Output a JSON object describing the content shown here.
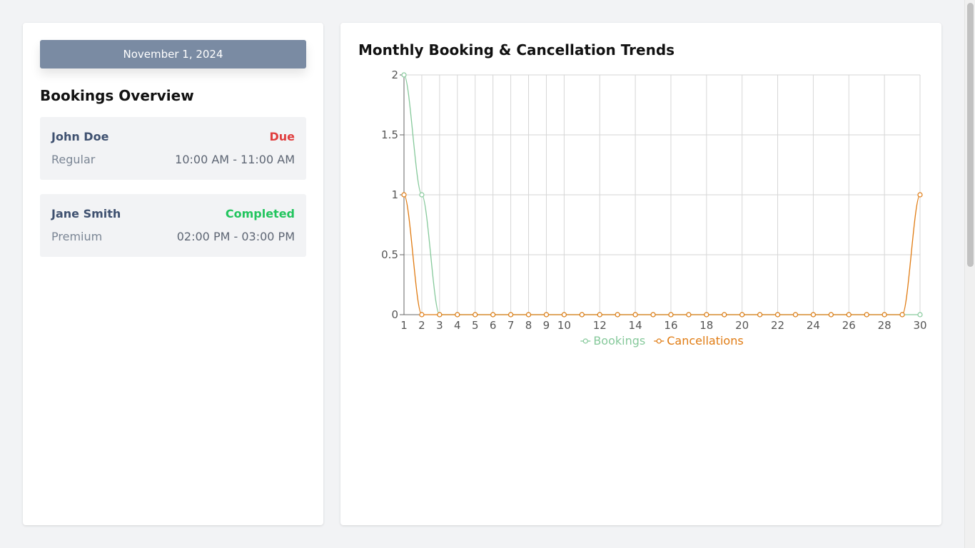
{
  "sidebar": {
    "date_label": "November 1, 2024",
    "section_title": "Bookings Overview",
    "bookings": [
      {
        "name": "John Doe",
        "status": "Due",
        "status_color": "#e03e3e",
        "plan": "Regular",
        "time": "10:00 AM - 11:00 AM"
      },
      {
        "name": "Jane Smith",
        "status": "Completed",
        "status_color": "#22c55e",
        "plan": "Premium",
        "time": "02:00 PM - 03:00 PM"
      }
    ]
  },
  "chart": {
    "title": "Monthly Booking & Cancellation Trends"
  },
  "chart_data": {
    "type": "line",
    "title": "Monthly Booking & Cancellation Trends",
    "xlabel": "",
    "ylabel": "",
    "x": [
      1,
      2,
      3,
      4,
      5,
      6,
      7,
      8,
      9,
      10,
      11,
      12,
      13,
      14,
      15,
      16,
      17,
      18,
      19,
      20,
      21,
      22,
      23,
      24,
      25,
      26,
      27,
      28,
      29,
      30
    ],
    "x_tick_labels": [
      "1",
      "2",
      "3",
      "4",
      "5",
      "6",
      "7",
      "8",
      "9",
      "10",
      "12",
      "14",
      "16",
      "18",
      "20",
      "22",
      "24",
      "26",
      "28",
      "30"
    ],
    "y_tick_labels": [
      "0",
      "0.5",
      "1",
      "1.5",
      "2"
    ],
    "ylim": [
      0,
      2
    ],
    "grid": true,
    "legend_position": "bottom",
    "series": [
      {
        "name": "Bookings",
        "color": "#86c99b",
        "values": [
          2,
          1,
          0,
          0,
          0,
          0,
          0,
          0,
          0,
          0,
          0,
          0,
          0,
          0,
          0,
          0,
          0,
          0,
          0,
          0,
          0,
          0,
          0,
          0,
          0,
          0,
          0,
          0,
          0,
          0
        ]
      },
      {
        "name": "Cancellations",
        "color": "#e07b12",
        "values": [
          1,
          0,
          0,
          0,
          0,
          0,
          0,
          0,
          0,
          0,
          0,
          0,
          0,
          0,
          0,
          0,
          0,
          0,
          0,
          0,
          0,
          0,
          0,
          0,
          0,
          0,
          0,
          0,
          0,
          1
        ]
      }
    ]
  }
}
